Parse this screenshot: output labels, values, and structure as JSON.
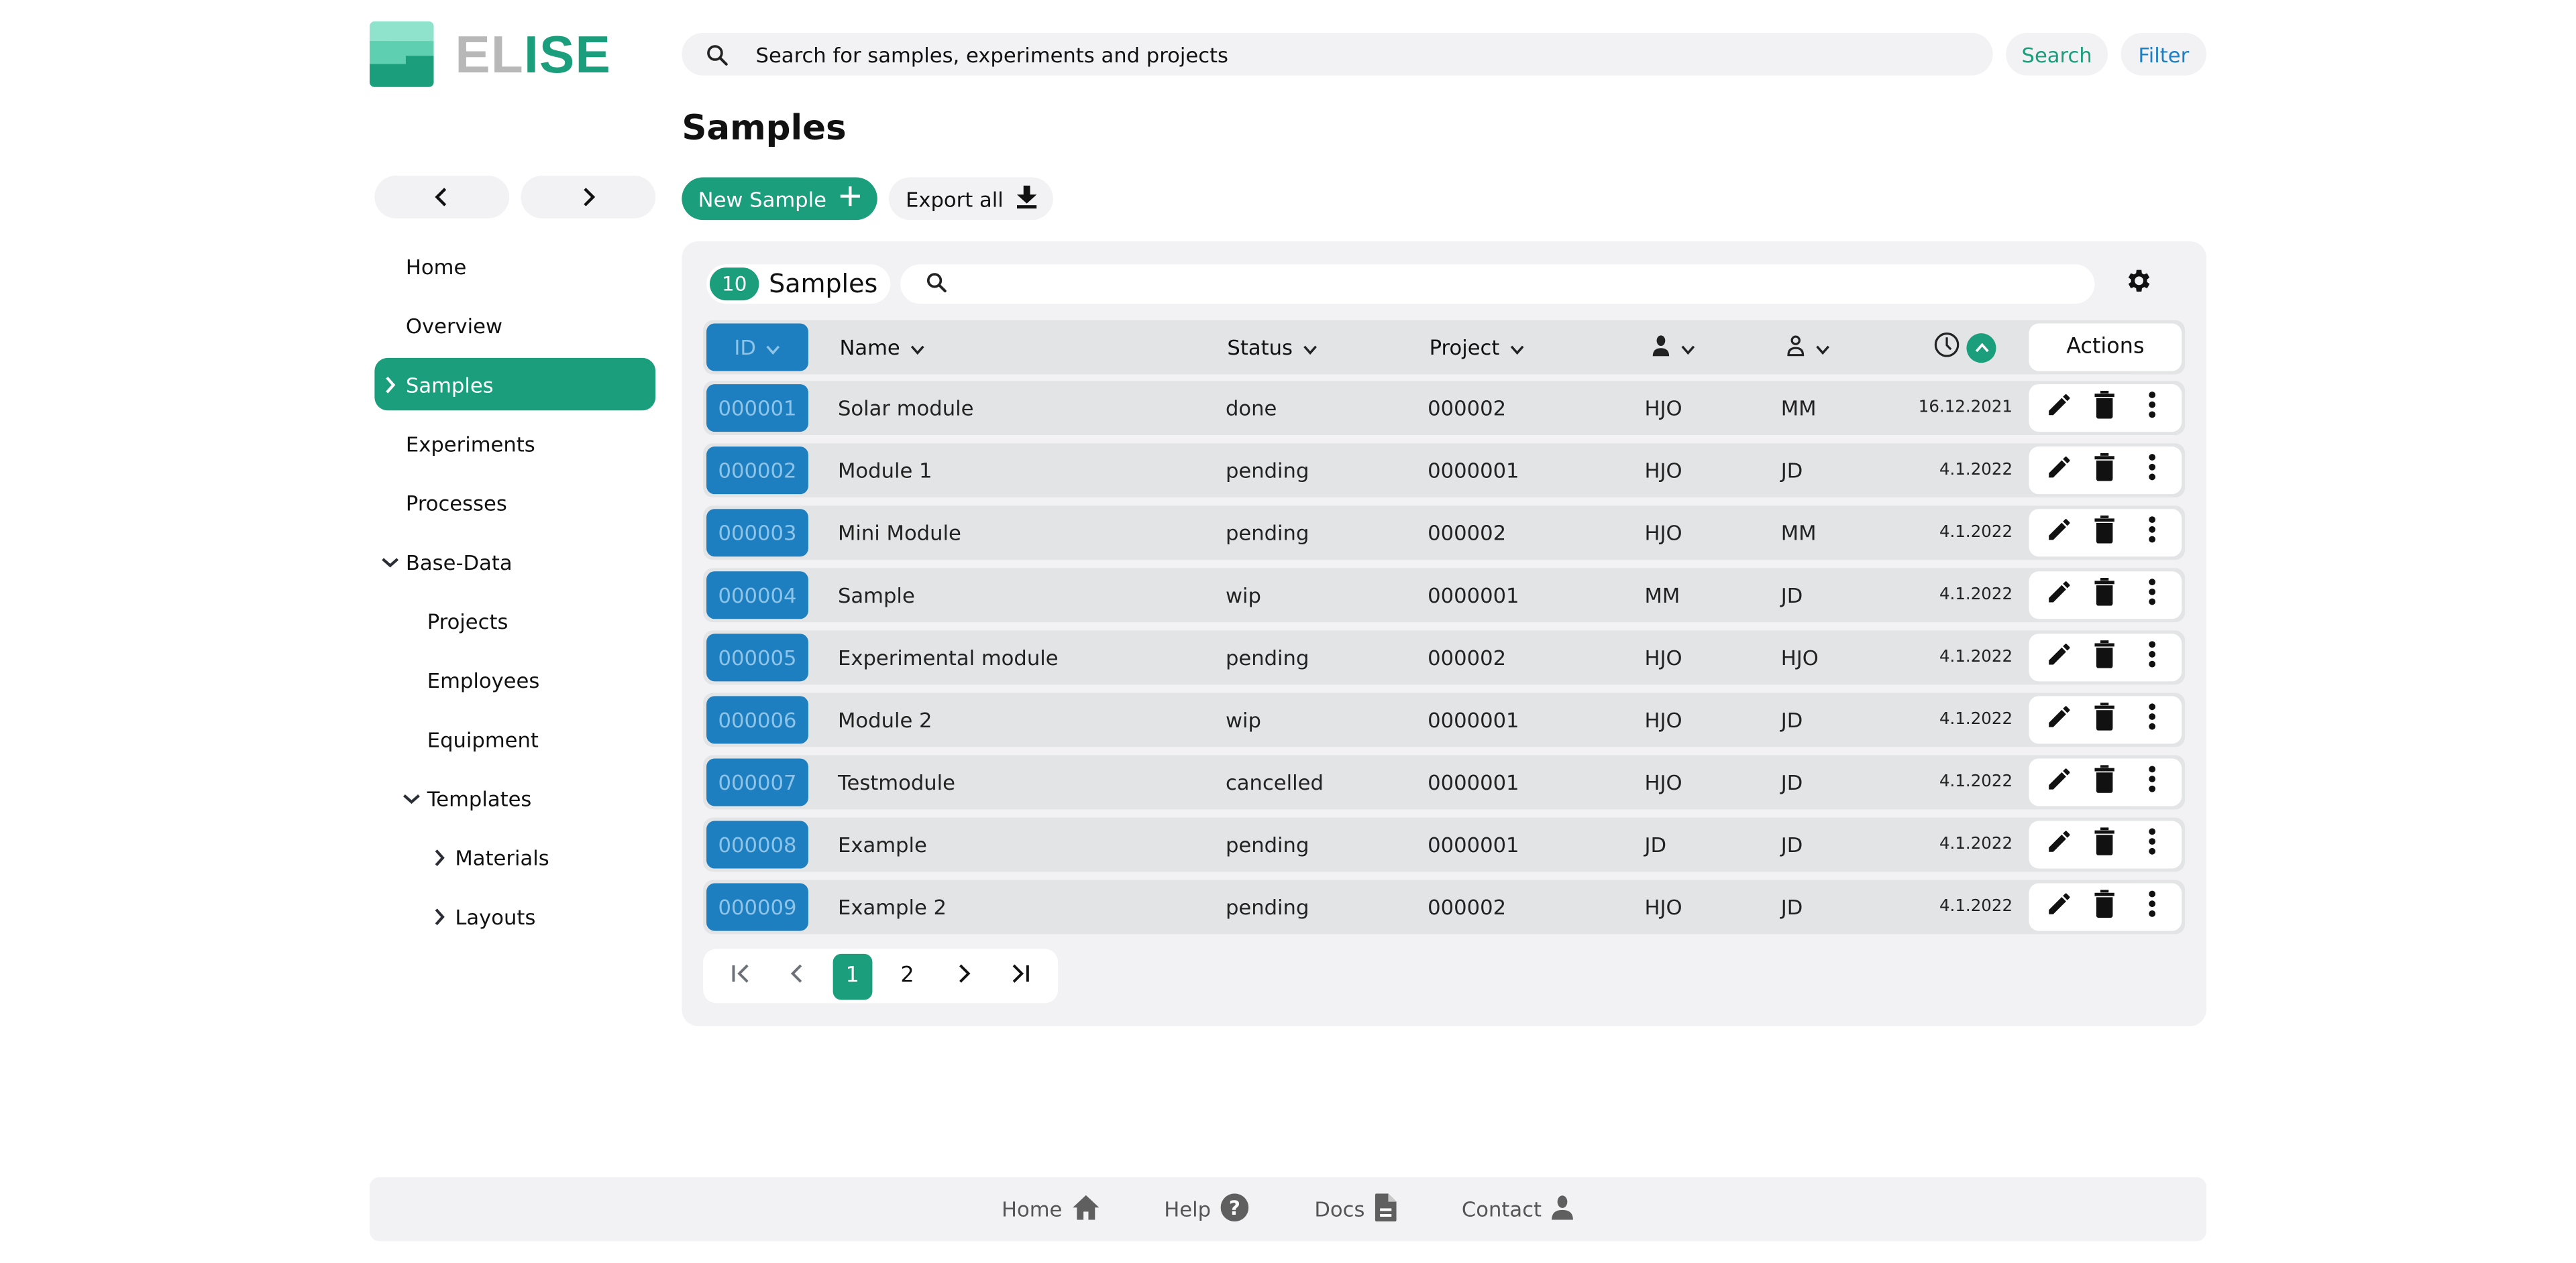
{
  "app": {
    "logo_part1": "EL",
    "logo_part2": "ISE",
    "colors": {
      "brand_green": "#1a9e7c",
      "brand_blue": "#1e7fc0",
      "panel_bg": "#f2f2f4",
      "row_bg": "#e3e4e6"
    }
  },
  "header": {
    "search_placeholder": "Search for samples, experiments and projects",
    "search_value": "",
    "search_button": "Search",
    "filter_button": "Filter"
  },
  "sidebar": {
    "back_icon": "chevron-left-icon",
    "forward_icon": "chevron-right-icon",
    "items": [
      {
        "label": "Home",
        "level": 0,
        "chevron": "none",
        "active": false
      },
      {
        "label": "Overview",
        "level": 0,
        "chevron": "none",
        "active": false
      },
      {
        "label": "Samples",
        "level": 0,
        "chevron": "right",
        "active": true
      },
      {
        "label": "Experiments",
        "level": 0,
        "chevron": "none",
        "active": false
      },
      {
        "label": "Processes",
        "level": 0,
        "chevron": "none",
        "active": false
      },
      {
        "label": "Base-Data",
        "level": 0,
        "chevron": "down",
        "active": false
      },
      {
        "label": "Projects",
        "level": 1,
        "chevron": "none",
        "active": false
      },
      {
        "label": "Employees",
        "level": 1,
        "chevron": "none",
        "active": false
      },
      {
        "label": "Equipment",
        "level": 1,
        "chevron": "none",
        "active": false
      },
      {
        "label": "Templates",
        "level": 1,
        "chevron": "down",
        "active": false
      },
      {
        "label": "Materials",
        "level": 2,
        "chevron": "right",
        "active": false
      },
      {
        "label": "Layouts",
        "level": 2,
        "chevron": "right",
        "active": false
      }
    ]
  },
  "main": {
    "title": "Samples",
    "new_button": "New Sample",
    "export_button": "Export all",
    "table": {
      "count": "10",
      "count_label": "Samples",
      "search_placeholder": "",
      "search_value": "",
      "columns": {
        "id": "ID",
        "name": "Name",
        "status": "Status",
        "project": "Project",
        "user1_icon": "person-filled-icon",
        "user2_icon": "person-outline-icon",
        "date_icon": "clock-icon",
        "actions": "Actions"
      },
      "rows": [
        {
          "id": "000001",
          "name": "Solar module",
          "status": "done",
          "project": "000002",
          "user1": "HJO",
          "user2": "MM",
          "date": "16.12.2021"
        },
        {
          "id": "000002",
          "name": "Module 1",
          "status": "pending",
          "project": "0000001",
          "user1": "HJO",
          "user2": "JD",
          "date": "4.1.2022"
        },
        {
          "id": "000003",
          "name": "Mini Module",
          "status": "pending",
          "project": "000002",
          "user1": "HJO",
          "user2": "MM",
          "date": "4.1.2022"
        },
        {
          "id": "000004",
          "name": "Sample",
          "status": "wip",
          "project": "0000001",
          "user1": "MM",
          "user2": "JD",
          "date": "4.1.2022"
        },
        {
          "id": "000005",
          "name": "Experimental module",
          "status": "pending",
          "project": "000002",
          "user1": "HJO",
          "user2": "HJO",
          "date": "4.1.2022"
        },
        {
          "id": "000006",
          "name": "Module 2",
          "status": "wip",
          "project": "0000001",
          "user1": "HJO",
          "user2": "JD",
          "date": "4.1.2022"
        },
        {
          "id": "000007",
          "name": "Testmodule",
          "status": "cancelled",
          "project": "0000001",
          "user1": "HJO",
          "user2": "JD",
          "date": "4.1.2022"
        },
        {
          "id": "000008",
          "name": "Example",
          "status": "pending",
          "project": "0000001",
          "user1": "JD",
          "user2": "JD",
          "date": "4.1.2022"
        },
        {
          "id": "000009",
          "name": "Example 2",
          "status": "pending",
          "project": "000002",
          "user1": "HJO",
          "user2": "JD",
          "date": "4.1.2022"
        }
      ]
    },
    "pagination": {
      "pages": [
        "1",
        "2"
      ],
      "current_page": "1"
    }
  },
  "footer": {
    "links": [
      {
        "label": "Home",
        "icon": "home-icon"
      },
      {
        "label": "Help",
        "icon": "help-icon"
      },
      {
        "label": "Docs",
        "icon": "document-icon"
      },
      {
        "label": "Contact",
        "icon": "contact-icon"
      }
    ]
  }
}
